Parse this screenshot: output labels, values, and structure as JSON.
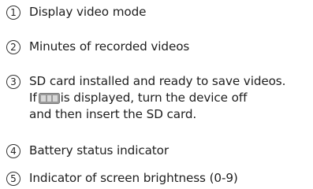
{
  "items": [
    {
      "number": "1",
      "lines": [
        "Display video mode"
      ]
    },
    {
      "number": "2",
      "lines": [
        "Minutes of recorded videos"
      ]
    },
    {
      "number": "3",
      "lines": [
        "SD card installed and ready to save videos.",
        "If",
        "is displayed, turn the device off",
        "and then insert the SD card."
      ]
    },
    {
      "number": "4",
      "lines": [
        "Battery status indicator"
      ]
    },
    {
      "number": "5",
      "lines": [
        "Indicator of screen brightness (0-9)"
      ]
    }
  ],
  "icons": {
    "sd_card_missing": "sd-card-icon"
  },
  "colors": {
    "text": "#1e1e1e",
    "icon_body": "#9a9a9a"
  }
}
